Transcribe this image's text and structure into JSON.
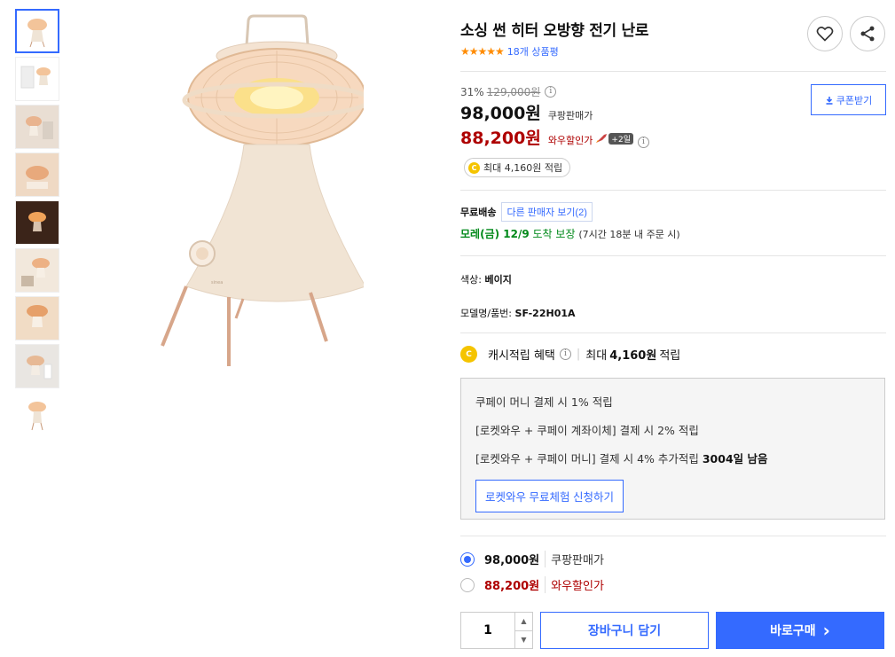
{
  "product": {
    "title": "소싱 썬 히터 오방향 전기 난로",
    "stars": "★★★★★",
    "review_count": "18개 상품평"
  },
  "icons": {
    "wishlist": "heart-icon",
    "share": "share-icon",
    "info": "i",
    "cash_coin": "C"
  },
  "price": {
    "discount_rate": "31%",
    "original": "129,000원",
    "main": "98,000원",
    "main_label": "쿠팡판매가",
    "wow": "88,200원",
    "wow_label": "와우할인가",
    "wow_badge": "+2일",
    "coupon_button": "쿠폰받기",
    "cash_pill": "최대 4,160원 적립"
  },
  "shipping": {
    "label": "무료배송",
    "other_sellers": "다른 판매자 보기(2)",
    "arrival_day": "모레(금) 12/9",
    "arrival_text": " 도착 보장 ",
    "arrival_note": "(7시간 18분 내 주문 시)"
  },
  "options": {
    "color_label": "색상:",
    "color_value": "베이지",
    "model_label": "모델명/품번:",
    "model_value": "SF-22H01A"
  },
  "cash_benefit": {
    "label": "캐시적립 혜택",
    "value_prefix": "최대 ",
    "value_amount": "4,160원",
    "value_suffix": " 적립"
  },
  "benefits": {
    "line1": "쿠페이 머니 결제 시 1% 적립",
    "line2": "[로켓와우 + 쿠페이 계좌이체] 결제 시 2% 적립",
    "line3": "[로켓와우 + 쿠페이 머니] 결제 시 4% 추가적립 ",
    "line3_bold": "3004일 남음",
    "trial_button": "로켓와우 무료체험 신청하기"
  },
  "price_options": [
    {
      "price": "98,000원",
      "label": "쿠팡판매가",
      "selected": true
    },
    {
      "price": "88,200원",
      "label": "와우할인가",
      "selected": false
    }
  ],
  "purchase": {
    "quantity": "1",
    "cart_button": "장바구니 담기",
    "buy_button": "바로구매",
    "buy_arrow": "›"
  },
  "colors": {
    "accent": "#346aff",
    "wow_red": "#ae0000",
    "arrival_green": "#00891a",
    "star_orange": "#ff8b00",
    "heater_beige": "#f1e4d4"
  }
}
